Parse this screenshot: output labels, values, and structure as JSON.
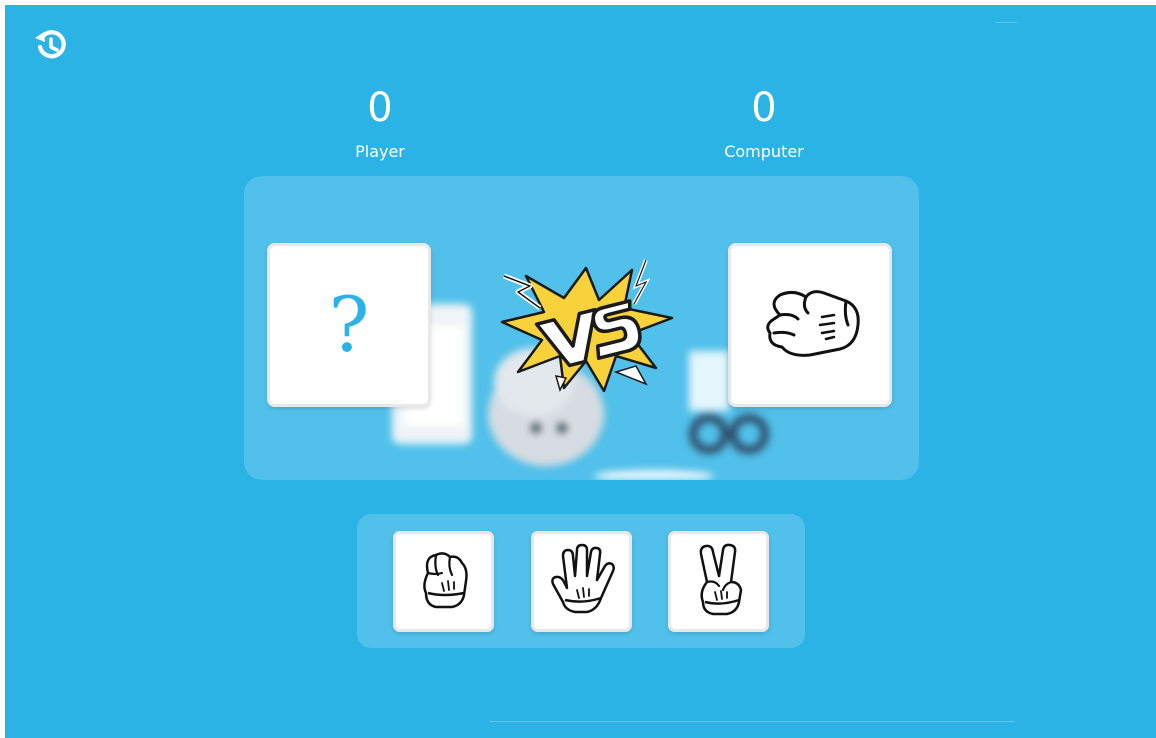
{
  "scoreboard": {
    "player": {
      "score": "0",
      "label": "Player"
    },
    "computer": {
      "score": "0",
      "label": "Computer"
    }
  },
  "arena": {
    "player_choice": "?",
    "computer_choice_icon": "rock-hand-icon",
    "vs_icon": "vs-burst-icon"
  },
  "choices": [
    {
      "name": "rock",
      "icon": "rock-hand-icon"
    },
    {
      "name": "paper",
      "icon": "paper-hand-icon"
    },
    {
      "name": "scissors",
      "icon": "scissors-hand-icon"
    }
  ],
  "toolbar": {
    "history_icon": "history-icon"
  },
  "colors": {
    "background": "#2bb3e6",
    "question_mark": "#2bb3e6",
    "vs_yellow": "#f7d23a",
    "panel": "rgba(255,255,255,0.18)"
  }
}
